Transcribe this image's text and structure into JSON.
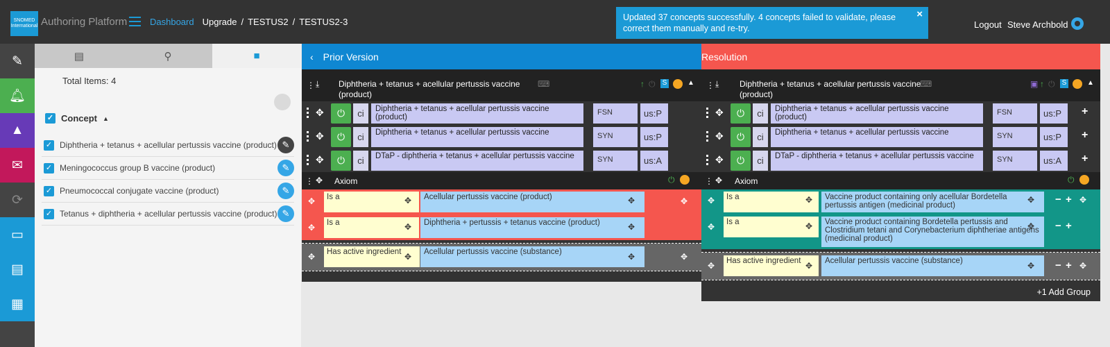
{
  "header": {
    "app_title": "Authoring Platform",
    "dashboard": "Dashboard",
    "crumbs": [
      "Upgrade",
      "/",
      "TESTUS2",
      "/",
      "TESTUS2-3"
    ],
    "toast": "Updated 37 concepts successfully. 4 concepts failed to validate, please correct them manually and re-try.",
    "toast_close": "×",
    "logout": "Logout",
    "user": "Steve Archbold",
    "logo_text": "SNOMED International"
  },
  "left_nav": {
    "colors": [
      "#444444",
      "#4caf50",
      "#673ab7",
      "#c2185b",
      "#444444",
      "#1b9ad6",
      "#1b9ad6",
      "#1b9ad6"
    ],
    "icons": [
      "edit-icon",
      "bell-icon",
      "graduation-cap-icon",
      "mail-icon",
      "sync-icon",
      "monitor-icon",
      "window-icon",
      "grid-icon"
    ]
  },
  "left_panel": {
    "total": "Total Items: 4",
    "concept_header": "Concept",
    "items": [
      "Diphtheria + tetanus + acellular pertussis vaccine (product)",
      "Meningococcus group B vaccine (product)",
      "Pneumococcal conjugate vaccine (product)",
      "Tetanus + diphtheria + acellular pertussis vaccine (product)"
    ]
  },
  "prior": {
    "header": "Prior Version",
    "title": "Diphtheria + tetanus + acellular pertussis vaccine (product)",
    "descriptions": [
      {
        "ci": "ci",
        "term": "Diphtheria + tetanus + acellular pertussis vaccine (product)",
        "type": "FSN",
        "lang": "us:P"
      },
      {
        "ci": "ci",
        "term": "Diphtheria + tetanus + acellular pertussis vaccine",
        "type": "SYN",
        "lang": "us:P"
      },
      {
        "ci": "ci",
        "term": "DTaP - diphtheria + tetanus + acellular pertussis vaccine",
        "type": "SYN",
        "lang": "us:A"
      }
    ],
    "axiom": "Axiom",
    "relationships": [
      {
        "attr": "Is a",
        "target": "Acellular pertussis vaccine (product)"
      },
      {
        "attr": "Is a",
        "target": "Diphtheria + pertussis + tetanus vaccine (product)"
      }
    ],
    "group": [
      {
        "attr": "Has active ingredient",
        "target": "Acellular pertussis vaccine (substance)"
      }
    ]
  },
  "resolution": {
    "header": "Resolution",
    "title": "Diphtheria + tetanus + acellular pertussis vaccine (product)",
    "descriptions": [
      {
        "ci": "ci",
        "term": "Diphtheria + tetanus + acellular pertussis vaccine (product)",
        "type": "FSN",
        "lang": "us:P"
      },
      {
        "ci": "ci",
        "term": "Diphtheria + tetanus + acellular pertussis vaccine",
        "type": "SYN",
        "lang": "us:P"
      },
      {
        "ci": "ci",
        "term": "DTaP - diphtheria + tetanus + acellular pertussis vaccine",
        "type": "SYN",
        "lang": "us:A"
      }
    ],
    "axiom": "Axiom",
    "relationships": [
      {
        "attr": "Is a",
        "target": "Vaccine product containing only acellular Bordetella pertussis antigen (medicinal product)"
      },
      {
        "attr": "Is a",
        "target": "Vaccine product containing Bordetella pertussis and Clostridium tetani and Corynebacterium diphtheriae antigens (medicinal product)"
      }
    ],
    "group": [
      {
        "attr": "Has active ingredient",
        "target": "Acellular pertussis vaccine (substance)"
      }
    ],
    "add_group": "+1 Add Group"
  },
  "colors": {
    "prior_header": "#0f87d2",
    "resolution_header": "#f5564e",
    "prior_rel_bg": "#f5564e",
    "resolution_rel_bg": "#129688",
    "group_bg": "#666666"
  }
}
